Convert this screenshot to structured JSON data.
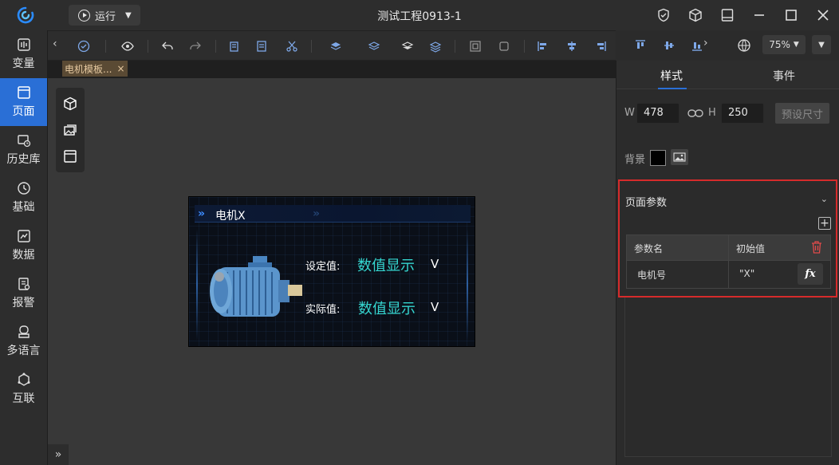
{
  "app": {
    "title": "测试工程0913-1",
    "accent_color": "#2a6fd6",
    "run_button": {
      "label": "运行",
      "icon": "play-icon"
    },
    "window_controls": [
      "shield-icon",
      "cube-icon",
      "layout-icon",
      "minimize-icon",
      "maximize-icon",
      "close-icon"
    ]
  },
  "sidebar": {
    "items": [
      {
        "label": "变量",
        "icon": "variable-icon",
        "active": false
      },
      {
        "label": "页面",
        "icon": "page-icon",
        "active": true
      },
      {
        "label": "历史库",
        "icon": "history-db-icon",
        "active": false
      },
      {
        "label": "基础",
        "icon": "basic-icon",
        "active": false
      },
      {
        "label": "数据",
        "icon": "data-icon",
        "active": false
      },
      {
        "label": "报警",
        "icon": "alarm-icon",
        "active": false
      },
      {
        "label": "多语言",
        "icon": "language-icon",
        "active": false
      },
      {
        "label": "互联",
        "icon": "interconnect-icon",
        "active": false
      }
    ],
    "expand_label": "»"
  },
  "toolbar": {
    "zoom": "75%"
  },
  "tabs": [
    {
      "label": "电机模板...",
      "close": "×"
    }
  ],
  "canvas_page": {
    "header_title": "电机X",
    "rows": [
      {
        "label": "设定值:",
        "value": "数值显示",
        "unit": "V"
      },
      {
        "label": "实际值:",
        "value": "数值显示",
        "unit": "V"
      }
    ]
  },
  "properties": {
    "tabs": [
      {
        "label": "样式",
        "active": true
      },
      {
        "label": "事件",
        "active": false
      }
    ],
    "w_label": "W",
    "w_value": "478",
    "h_label": "H",
    "h_value": "250",
    "preset_size_label": "预设尺寸",
    "background_label": "背景",
    "background_color": "#000000",
    "page_params": {
      "title": "页面参数",
      "columns": [
        "参数名",
        "初始值"
      ],
      "rows": [
        {
          "name": "电机号",
          "initial": "\"X\""
        }
      ],
      "fx_label": "fx"
    }
  }
}
